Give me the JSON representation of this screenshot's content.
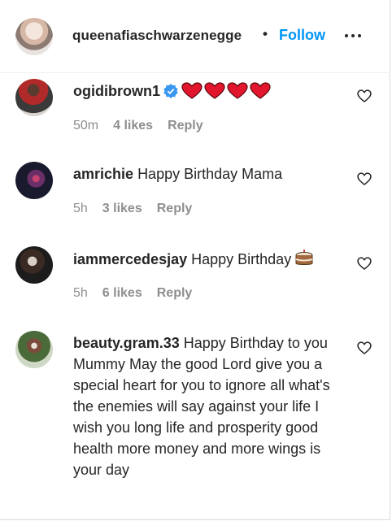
{
  "header": {
    "username": "queenafiaschwarzenegge",
    "separator": "•",
    "follow_label": "Follow",
    "more_icon": "more-horizontal-icon"
  },
  "colors": {
    "link": "#0095f6",
    "text": "#262626",
    "muted": "#8e8e8e",
    "heart_red": "#ed4956",
    "verified_blue": "#3897f0"
  },
  "comments": [
    {
      "username": "ogidibrown1",
      "text": "",
      "verified": true,
      "emoji": "red-hearts-x4",
      "time": "50m",
      "likes": "4 likes",
      "reply": "Reply"
    },
    {
      "username": "amrichie",
      "text": "Happy Birthday Mama",
      "time": "5h",
      "likes": "3 likes",
      "reply": "Reply"
    },
    {
      "username": "iammercedesjay",
      "text": "Happy Birthday",
      "emoji": "birthday-cake",
      "time": "5h",
      "likes": "6 likes",
      "reply": "Reply"
    },
    {
      "username": "beauty.gram.33",
      "text": "Happy Birthday to you Mummy May the good Lord give you a special heart for you to ignore all what's the enemies will say against your life I wish you long life and prosperity good health more money and more wings is your day"
    }
  ]
}
